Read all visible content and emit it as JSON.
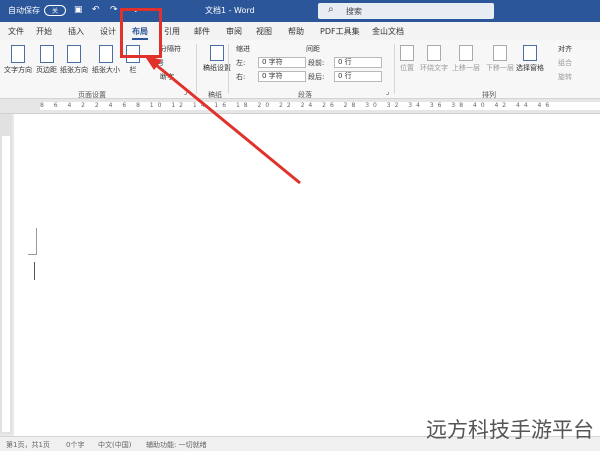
{
  "titlebar": {
    "autosave_label": "自动保存",
    "autosave_state": "关",
    "undo_icon": "↶",
    "redo_icon": "↷",
    "save_icon": "▣",
    "customize_icon": "⌄",
    "doc_title": "文档1 - Word",
    "search_label": "搜索"
  },
  "tabs": [
    "文件",
    "开始",
    "插入",
    "设计",
    "布局",
    "引用",
    "邮件",
    "审阅",
    "视图",
    "帮助",
    "PDF工具集",
    "金山文档"
  ],
  "active_tab": "布局",
  "ribbon": {
    "text_direction": "文字方向",
    "margins": "页边距",
    "orientation": "纸张方向",
    "size": "纸张大小",
    "columns": "栏",
    "breaks": "分隔符",
    "line_numbers": "行号",
    "hyphenation": "断字",
    "page_setup_group": "页面设置",
    "draft_paper": "稿纸设置",
    "draft_group": "稿纸",
    "indent_label": "缩进",
    "spacing_label": "间距",
    "left_label": "左:",
    "left_value": "0 字符",
    "right_label": "右:",
    "right_value": "0 字符",
    "before_label": "段前:",
    "before_value": "0 行",
    "after_label": "段后:",
    "after_value": "0 行",
    "paragraph_group": "段落",
    "position": "位置",
    "wrap_text": "环绕文字",
    "bring_forward": "上移一层",
    "send_backward": "下移一层",
    "selection_pane": "选择窗格",
    "align": "对齐",
    "group": "组合",
    "rotate": "旋转",
    "arrange_group": "排列"
  },
  "ruler_text": "8 6 4 2   2 4 6 8 10 12 14 16 18 20 22 24 26 28 30 32 34 36 38 40 42 44 46",
  "statusbar": {
    "page": "第1页，共1页",
    "words": "0个字",
    "language": "中文(中国)",
    "accessibility": "辅助功能: 一切就绪"
  },
  "watermark": "远方科技手游平台",
  "colors": {
    "title_bg": "#2b579a",
    "highlight": "#e0322a"
  }
}
